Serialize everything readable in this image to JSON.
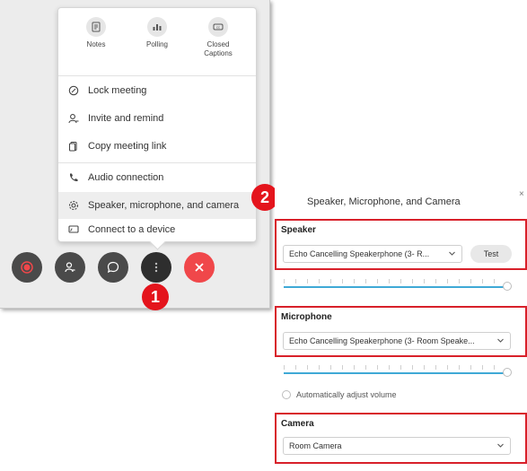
{
  "menu": {
    "quick_actions": [
      {
        "label": "Notes",
        "icon": "notes-icon"
      },
      {
        "label": "Polling",
        "icon": "polling-icon"
      },
      {
        "label": "Closed Captions",
        "icon": "closed-captions-icon"
      }
    ],
    "items": [
      {
        "label": "Lock meeting",
        "icon": "lock-icon"
      },
      {
        "label": "Invite and remind",
        "icon": "invite-icon"
      },
      {
        "label": "Copy meeting link",
        "icon": "copy-link-icon"
      },
      {
        "label": "Audio connection",
        "icon": "phone-icon"
      },
      {
        "label": "Speaker, microphone, and camera",
        "icon": "settings-icon"
      },
      {
        "label": "Connect to a device",
        "icon": "device-icon"
      }
    ]
  },
  "controls": [
    {
      "name": "record",
      "icon": "record-icon"
    },
    {
      "name": "participants",
      "icon": "participants-icon"
    },
    {
      "name": "chat",
      "icon": "chat-icon"
    },
    {
      "name": "more",
      "icon": "more-options-icon"
    },
    {
      "name": "end",
      "icon": "close-icon"
    }
  ],
  "badges": {
    "step1": "1",
    "step2": "2"
  },
  "dialog": {
    "title": "Speaker, Microphone, and Camera",
    "close": "×",
    "speaker": {
      "label": "Speaker",
      "value": "Echo Cancelling Speakerphone (3- R...",
      "test_label": "Test"
    },
    "microphone": {
      "label": "Microphone",
      "value": "Echo Cancelling Speakerphone (3- Room Speake..."
    },
    "auto_volume_label": "Automatically adjust volume",
    "camera": {
      "label": "Camera",
      "value": "Room Camera"
    }
  },
  "colors": {
    "highlight_red": "#d8202a",
    "badge_red": "#e4141c",
    "end_call_red": "#f0474a",
    "control_dark": "#4a4a4a",
    "slider_blue": "#3fa9d6"
  }
}
